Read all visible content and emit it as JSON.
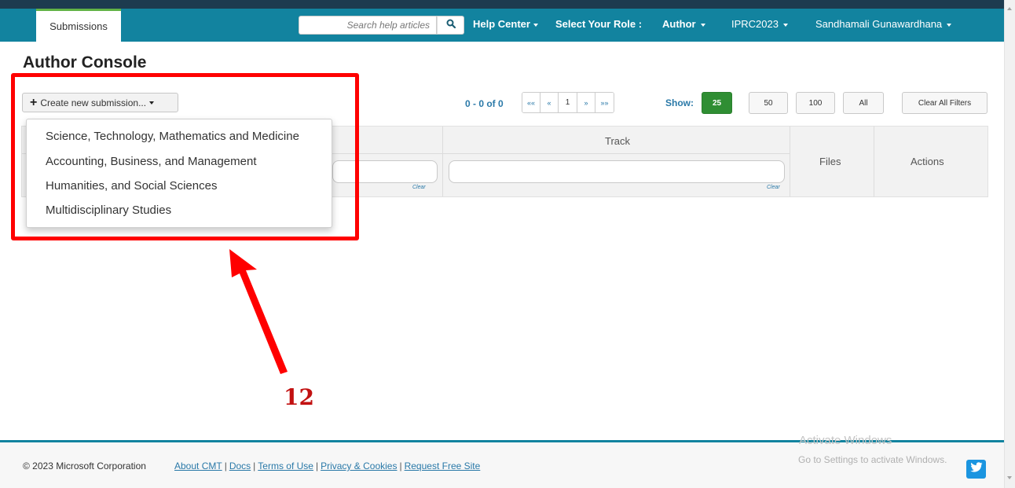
{
  "nav": {
    "tab": "Submissions",
    "search_placeholder": "Search help articles",
    "help_center": "Help Center",
    "role_label": "Select Your Role :",
    "role": "Author",
    "conference": "IPRC2023",
    "user": "Sandhamali Gunawardhana"
  },
  "page_title": "Author Console",
  "toolbar": {
    "create_label": "Create new submission...",
    "count": "0 - 0 of 0",
    "pager": [
      "««",
      "«",
      "1",
      "»",
      "»»"
    ],
    "show_label": "Show:",
    "show_options": [
      "25",
      "50",
      "100",
      "All"
    ],
    "active_show": "25",
    "clear_all": "Clear All Filters"
  },
  "table": {
    "columns": [
      "Track",
      "Files",
      "Actions"
    ],
    "clear_link": "Clear"
  },
  "dropdown": {
    "items": [
      "Science, Technology, Mathematics and Medicine",
      "Accounting, Business, and Management",
      "Humanities, and Social Sciences",
      "Multidisciplinary Studies"
    ]
  },
  "annotation": {
    "number": "12",
    "color": "#ff0000"
  },
  "footer": {
    "copyright": "© 2023 Microsoft Corporation",
    "links": [
      "About CMT",
      "Docs",
      "Terms of Use",
      "Privacy & Cookies",
      "Request Free Site"
    ],
    "separator": "|"
  },
  "watermark": {
    "line1": "Activate Windows",
    "line2": "Go to Settings to activate Windows."
  },
  "colors": {
    "navbar": "#12839f",
    "accent_green": "#2f8e33",
    "link": "#2a79a8"
  },
  "icons": [
    "search-icon",
    "plus-icon",
    "twitter-icon"
  ]
}
